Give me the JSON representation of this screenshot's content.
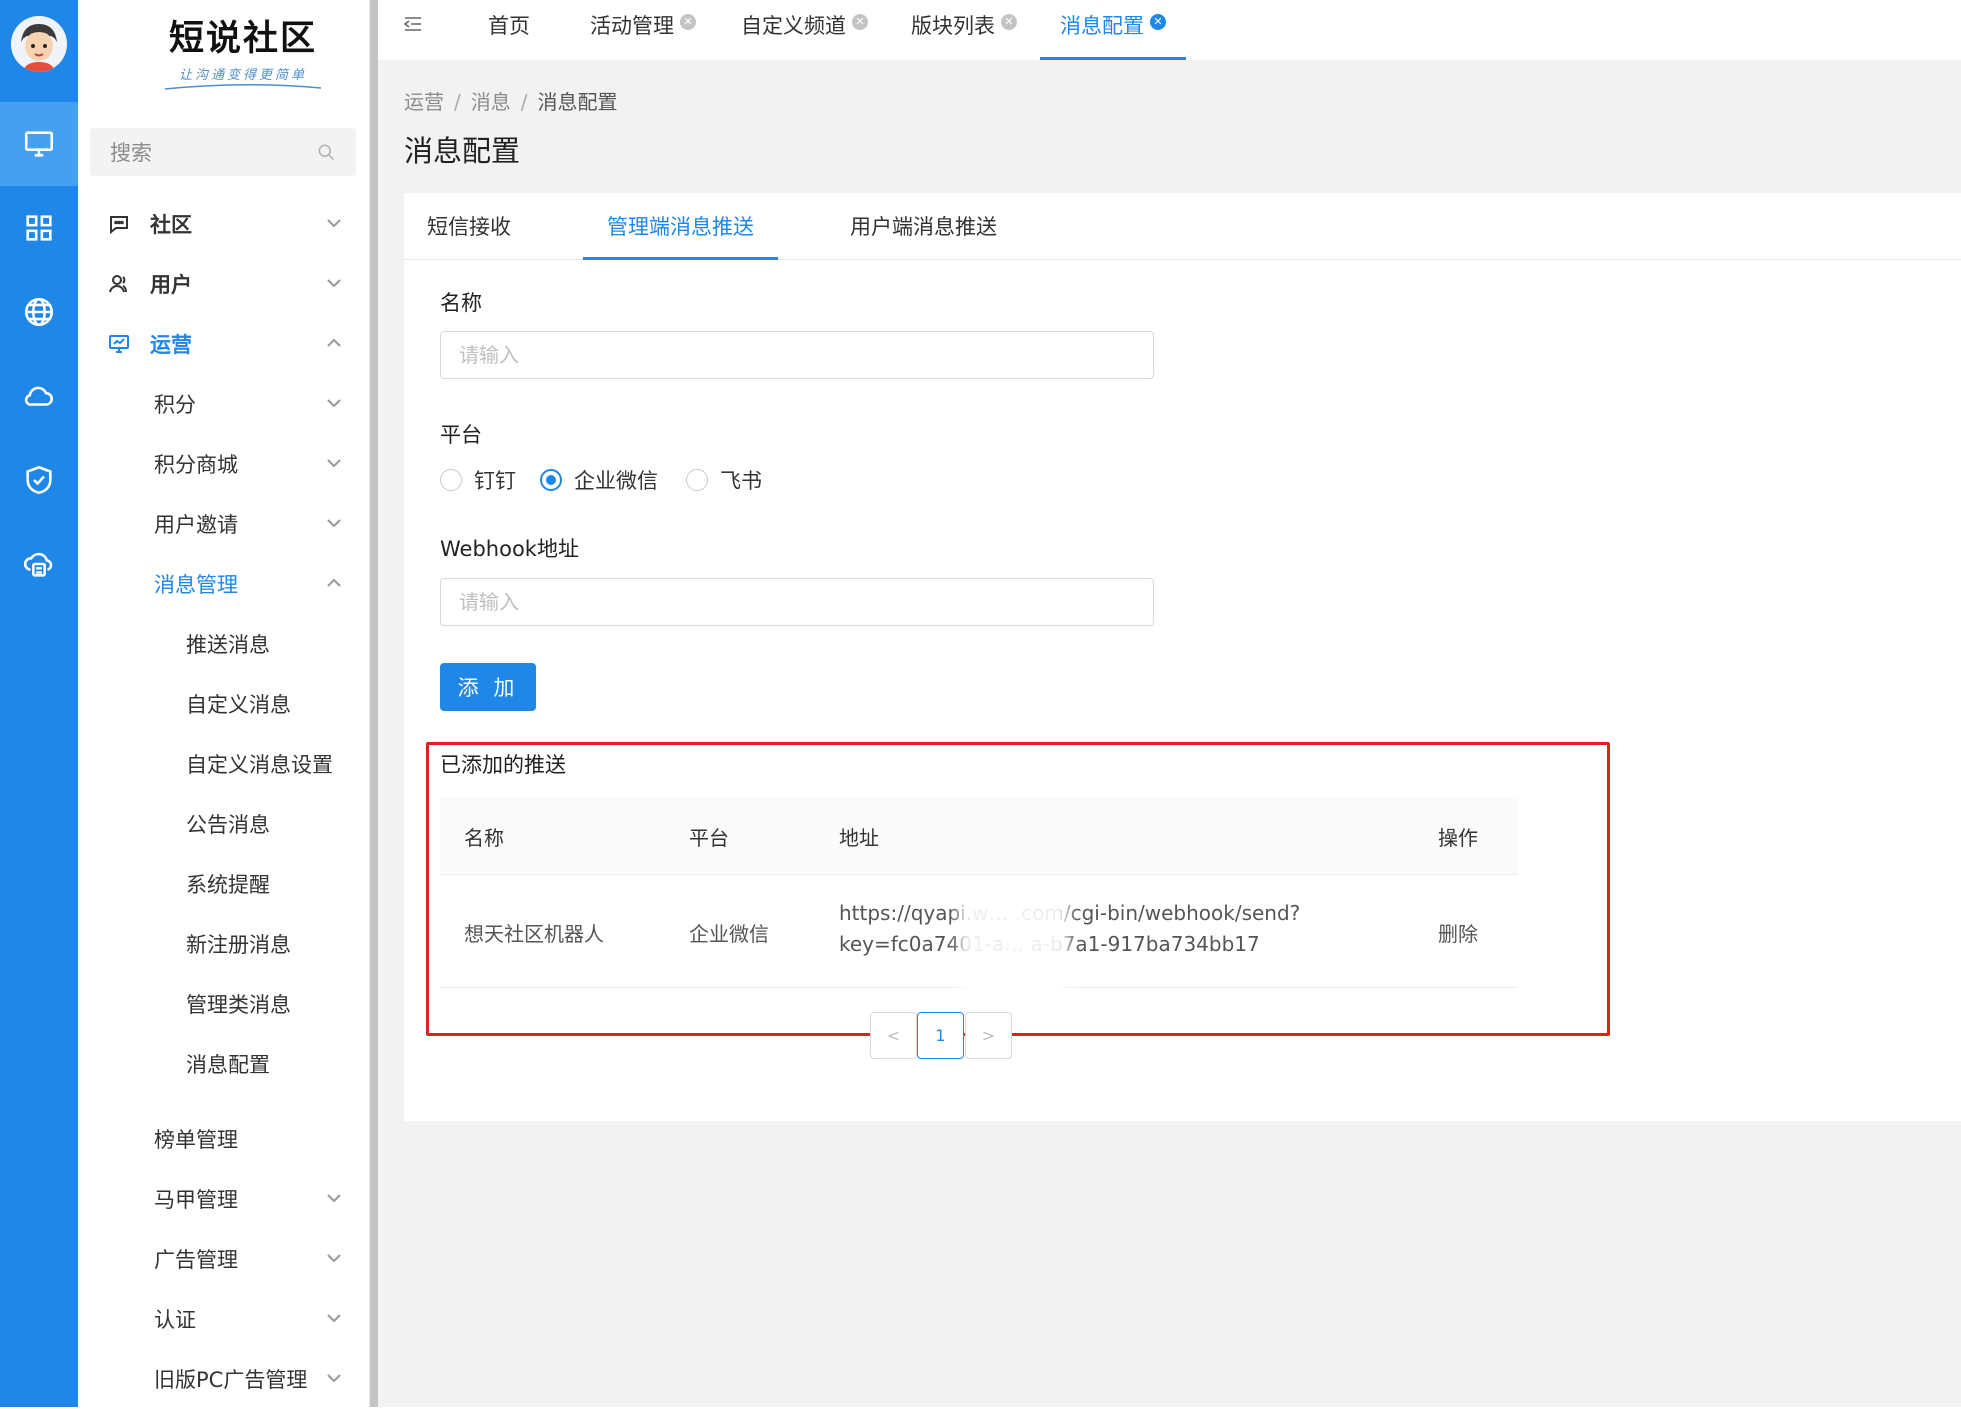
{
  "logo": {
    "title": "短说社区",
    "subtitle": "让沟通变得更简单"
  },
  "sidebar": {
    "search_placeholder": "搜索",
    "items": [
      {
        "label": "社区",
        "level": 0,
        "expanded": false,
        "icon": "chat-icon"
      },
      {
        "label": "用户",
        "level": 0,
        "expanded": false,
        "icon": "user-icon"
      },
      {
        "label": "运营",
        "level": 0,
        "expanded": true,
        "active": true,
        "icon": "monitor-chart-icon"
      },
      {
        "label": "积分",
        "level": 1
      },
      {
        "label": "积分商城",
        "level": 1
      },
      {
        "label": "用户邀请",
        "level": 1
      },
      {
        "label": "消息管理",
        "level": 1,
        "expanded": true,
        "active": true
      },
      {
        "label": "推送消息",
        "level": 2
      },
      {
        "label": "自定义消息",
        "level": 2
      },
      {
        "label": "自定义消息设置",
        "level": 2
      },
      {
        "label": "公告消息",
        "level": 2
      },
      {
        "label": "系统提醒",
        "level": 2
      },
      {
        "label": "新注册消息",
        "level": 2
      },
      {
        "label": "管理类消息",
        "level": 2
      },
      {
        "label": "消息配置",
        "level": 2
      },
      {
        "label": "榜单管理",
        "level": 1
      },
      {
        "label": "马甲管理",
        "level": 1
      },
      {
        "label": "广告管理",
        "level": 1
      },
      {
        "label": "认证",
        "level": 1
      },
      {
        "label": "旧版PC广告管理",
        "level": 1
      }
    ]
  },
  "rail": [
    "monitor-icon",
    "grid-icon",
    "globe-icon",
    "cloud-icon",
    "shield-check-icon",
    "cloud-server-icon"
  ],
  "tabs": [
    {
      "label": "首页",
      "closable": false
    },
    {
      "label": "活动管理",
      "closable": true
    },
    {
      "label": "自定义频道",
      "closable": true
    },
    {
      "label": "版块列表",
      "closable": true
    },
    {
      "label": "消息配置",
      "closable": true,
      "active": true
    }
  ],
  "breadcrumb": [
    "运营",
    "消息",
    "消息配置"
  ],
  "page_title": "消息配置",
  "content_tabs": [
    "短信接收",
    "管理端消息推送",
    "用户端消息推送"
  ],
  "form": {
    "name_label": "名称",
    "name_placeholder": "请输入",
    "platform_label": "平台",
    "platforms": [
      "钉钉",
      "企业微信",
      "飞书"
    ],
    "platform_selected": "企业微信",
    "webhook_label": "Webhook地址",
    "webhook_placeholder": "请输入",
    "add_button": "添 加"
  },
  "table": {
    "title": "已添加的推送",
    "columns": [
      "名称",
      "平台",
      "地址",
      "操作"
    ],
    "rows": [
      {
        "name": "想天社区机器人",
        "platform": "企业微信",
        "address_line1": "https://qyapi.w… .com/cgi-bin/webhook/send?",
        "address_line2": "key=fc0a7401-a… a-b7a1-917ba734bb17",
        "action": "删除"
      }
    ]
  },
  "pagination": {
    "prev": "<",
    "current": "1",
    "next": ">"
  },
  "colors": {
    "accent": "#1f87e8",
    "rail": "#1f87e8",
    "highlight_box": "#e0201d"
  }
}
